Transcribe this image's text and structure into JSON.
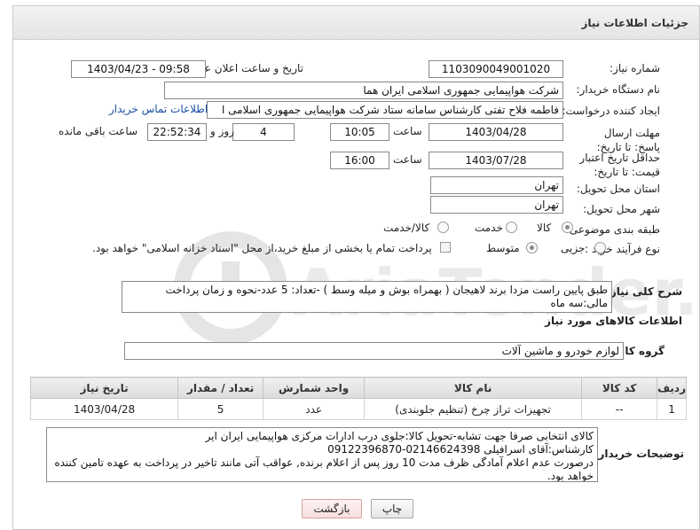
{
  "header": {
    "title": "جزئیات اطلاعات نیاز"
  },
  "fields": {
    "need_number_label": "شماره نیاز:",
    "need_number": "1103090049001020",
    "announce_label": "تاریخ و ساعت اعلان عمومی:",
    "announce_value": "1403/04/23 - 09:58",
    "buyer_org_label": "نام دستگاه خریدار:",
    "buyer_org": "شرکت هواپیمایی جمهوری اسلامی ایران هما",
    "requester_label": "ایجاد کننده درخواست:",
    "requester": "فاطمه فلاح تفتی کارشناس سامانه ستاد شرکت هواپیمایی جمهوری اسلامی ا",
    "contact_link": "اطلاعات تماس خریدار",
    "reply_deadline_label": "مهلت ارسال پاسخ: تا تاریخ:",
    "reply_date": "1403/04/28",
    "time_label": "ساعت",
    "reply_time": "10:05",
    "days_value": "4",
    "days_label": "روز و",
    "remaining_time": "22:52:34",
    "remaining_label": "ساعت باقی مانده",
    "price_validity_label": "حداقل تاریخ اعتبار قیمت: تا تاریخ:",
    "validity_date": "1403/07/28",
    "validity_time": "16:00",
    "province_label": "استان محل تحویل:",
    "province": "تهران",
    "city_label": "شهر محل تحویل:",
    "city": "تهران",
    "category_label": "طبقه بندی موضوعی:",
    "category_options": [
      "کالا",
      "خدمت",
      "کالا/خدمت"
    ],
    "purchase_type_label": "نوع فرآیند خرید :",
    "purchase_options": [
      "جزیی",
      "متوسط"
    ],
    "payment_note": "پرداخت تمام یا بخشی از مبلغ خرید،از محل \"اسناد خزانه اسلامی\" خواهد بود."
  },
  "description": {
    "label": "شرح کلی نیاز:",
    "text": "طبق پایین راست مزدا برند لاهیجان ( بهمراه بوش و میله وسط )  -تعداد: 5 عدد-نحوه و زمان پرداخت مالی:سه ماه"
  },
  "goods_section": {
    "title": "اطلاعات کالاهای مورد نیاز",
    "group_label": "گروه کالا:",
    "group_value": "لوازم خودرو و ماشین آلات"
  },
  "table": {
    "headers": [
      "ردیف",
      "کد کالا",
      "نام کالا",
      "واحد شمارش",
      "تعداد / مقدار",
      "تاریخ نیاز"
    ],
    "rows": [
      [
        "1",
        "--",
        "تجهیزات تراز چرخ (تنظیم جلوبندی)",
        "عدد",
        "5",
        "1403/04/28"
      ]
    ]
  },
  "buyer_notes": {
    "label": "توضیحات خریدار:",
    "lines": [
      "کالای انتخابی صرفا جهت تشابه-تحویل کالا:جلوی درب ادارات مرکزی هواپیمایی ایران ایر",
      "کارشناس:آقای اسرافیلی 02146624398-09122396870",
      "درصورت عدم اعلام آمادگی ظرف مدت 10 روز پس از اعلام برنده, عواقب آتی مانند تاخیر در پرداخت به عهده تامین کننده",
      "خواهد بود."
    ]
  },
  "buttons": {
    "print": "چاپ",
    "back": "بازگشت"
  },
  "watermark": {
    "text": "AriaTender.neT"
  }
}
